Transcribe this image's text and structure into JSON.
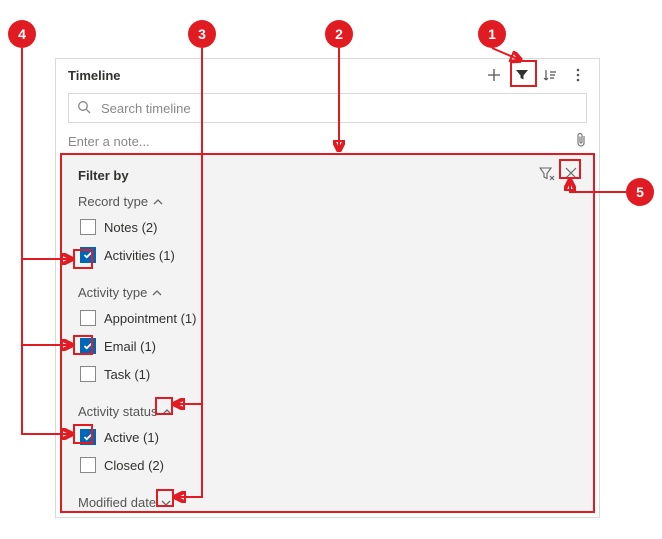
{
  "header": {
    "title": "Timeline",
    "search_placeholder": "Search timeline",
    "note_placeholder": "Enter a note..."
  },
  "panel": {
    "title": "Filter by",
    "groups": [
      {
        "label": "Record type",
        "expanded": true,
        "items": [
          {
            "label": "Notes (2)",
            "checked": false
          },
          {
            "label": "Activities (1)",
            "checked": true
          }
        ]
      },
      {
        "label": "Activity type",
        "expanded": true,
        "items": [
          {
            "label": "Appointment (1)",
            "checked": false
          },
          {
            "label": "Email (1)",
            "checked": true
          },
          {
            "label": "Task (1)",
            "checked": false
          }
        ]
      },
      {
        "label": "Activity status",
        "expanded": true,
        "items": [
          {
            "label": "Active (1)",
            "checked": true
          },
          {
            "label": "Closed (2)",
            "checked": false
          }
        ]
      },
      {
        "label": "Modified date",
        "expanded": false,
        "items": []
      }
    ]
  },
  "callouts": {
    "1": "1",
    "2": "2",
    "3": "3",
    "4": "4",
    "5": "5"
  }
}
